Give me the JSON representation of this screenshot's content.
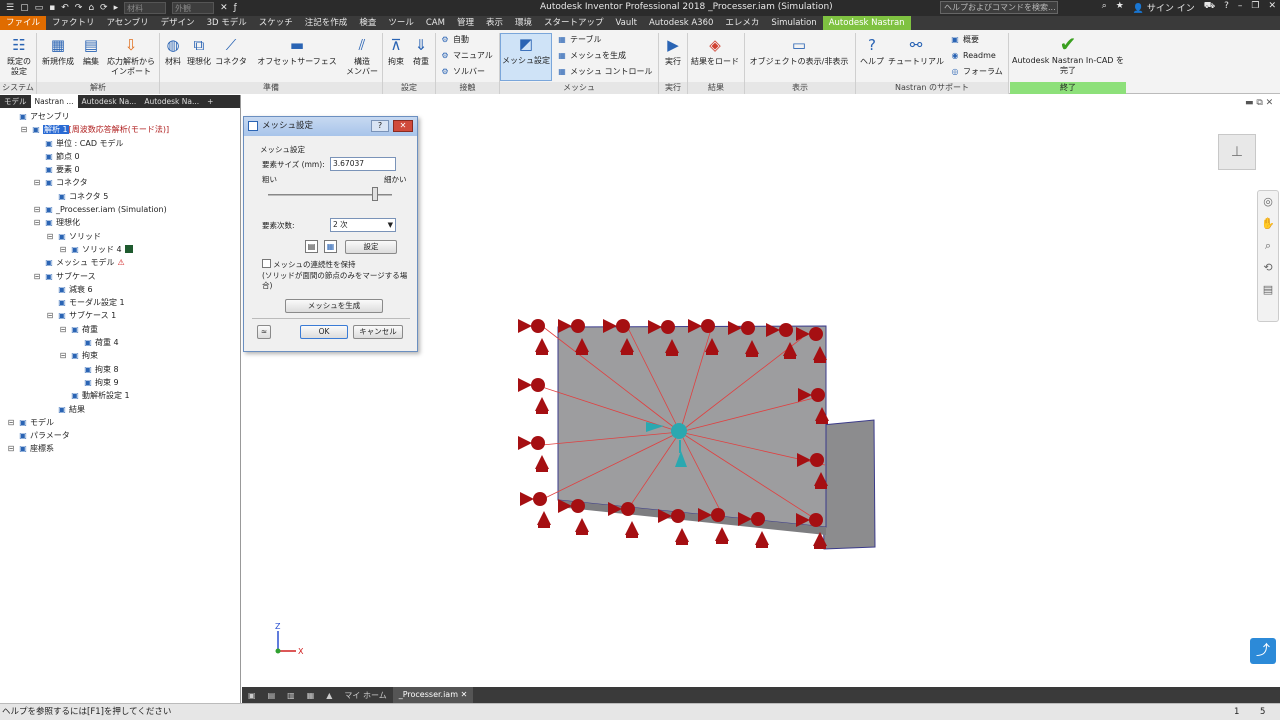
{
  "titlebar": {
    "title": "Autodesk Inventor Professional 2018   _Processer.iam (Simulation)",
    "material_placeholder": "材料",
    "appearance_placeholder": "外観",
    "search_placeholder": "ヘルプおよびコマンドを検索...",
    "signin": "サイン イン"
  },
  "menu": [
    "ファイル",
    "ファクトリ",
    "アセンブリ",
    "デザイン",
    "3D モデル",
    "スケッチ",
    "注記を作成",
    "検査",
    "ツール",
    "CAM",
    "管理",
    "表示",
    "環境",
    "スタートアップ",
    "Vault",
    "Autodesk A360",
    "エレメカ",
    "Simulation",
    "Autodesk Nastran"
  ],
  "ribbon": {
    "buttons": {
      "default_settings": "既定の\n設定",
      "new": "新規作成",
      "edit": "編集",
      "stress_import": "応力解析から\nインポート",
      "material": "材料",
      "idealize": "理想化",
      "connector": "コネクタ",
      "offset_surface": "オフセットサーフェス",
      "structural_member": "構造\nメンバー",
      "constraint": "拘束",
      "load": "荷重",
      "mesh_settings": "メッシュ設定",
      "run": "実行",
      "load_results": "結果をロード",
      "show_hide": "オブジェクトの表示/非表示",
      "help": "ヘルプ",
      "tutorial": "チュートリアル",
      "finish": "Autodesk Nastran In-CAD を\n完了"
    },
    "small": {
      "auto": "自動",
      "manual": "マニュアル",
      "solver": "ソルバー",
      "table": "テーブル",
      "generate_mesh": "メッシュを生成",
      "mesh_control": "メッシュ コントロール",
      "overview": "概要",
      "readme": "Readme",
      "forum": "フォーラム"
    },
    "groups": {
      "system": "システム",
      "analysis": "解析",
      "prepare": "準備",
      "setup": "設定",
      "contact": "接触",
      "mesh": "メッシュ",
      "run": "実行",
      "results": "結果",
      "display": "表示",
      "support": "Nastran のサポート",
      "finish": "終了"
    }
  },
  "browser": {
    "tabs": [
      "モデル",
      "Nastran ...",
      "Autodesk  Na...",
      "Autodesk  Na...",
      "+"
    ],
    "tree": [
      {
        "label": "アセンブリ",
        "icon": "assembly-icon",
        "d": 0
      },
      {
        "label": "解析 1",
        "extra": "[周波数応答解析(モード法)]",
        "icon": "analysis-icon",
        "d": 1,
        "hl": true
      },
      {
        "label": "単位 : CAD モデル",
        "icon": "units-icon",
        "d": 2
      },
      {
        "label": "節点 0",
        "icon": "node-icon",
        "d": 2
      },
      {
        "label": "要素 0",
        "icon": "element-icon",
        "d": 2
      },
      {
        "label": "コネクタ",
        "icon": "connector-icon",
        "d": 2
      },
      {
        "label": "コネクタ 5",
        "icon": "connector-item-icon",
        "d": 3
      },
      {
        "label": "_Processer.iam (Simulation)",
        "icon": "model-icon",
        "d": 2
      },
      {
        "label": "理想化",
        "icon": "idealize-icon",
        "d": 2
      },
      {
        "label": "ソリッド",
        "icon": "solid-icon",
        "d": 3
      },
      {
        "label": "ソリッド 4",
        "icon": "solid-item-icon",
        "d": 4
      },
      {
        "label": "メッシュ モデル",
        "icon": "mesh-icon",
        "d": 2,
        "warn": true
      },
      {
        "label": "サブケース",
        "icon": "subcase-icon",
        "d": 2
      },
      {
        "label": "減衰 6",
        "icon": "damping-icon",
        "d": 3
      },
      {
        "label": "モーダル設定 1",
        "icon": "modal-icon",
        "d": 3
      },
      {
        "label": "サブケース 1",
        "icon": "subcase-item-icon",
        "d": 3
      },
      {
        "label": "荷重",
        "icon": "load-icon",
        "d": 4
      },
      {
        "label": "荷重 4",
        "icon": "load-item-icon",
        "d": 5
      },
      {
        "label": "拘束",
        "icon": "constraint-icon",
        "d": 4
      },
      {
        "label": "拘束 8",
        "icon": "constraint-item-icon",
        "d": 5
      },
      {
        "label": "拘束 9",
        "icon": "constraint-item-icon",
        "d": 5
      },
      {
        "label": "動解析設定 1",
        "icon": "dynamic-icon",
        "d": 4
      },
      {
        "label": "結果",
        "icon": "results-icon",
        "d": 3
      },
      {
        "label": "モデル",
        "icon": "model-folder-icon",
        "d": 0
      },
      {
        "label": "パラメータ",
        "icon": "parameter-icon",
        "d": 0
      },
      {
        "label": "座標系",
        "icon": "coord-icon",
        "d": 0
      }
    ]
  },
  "dialog": {
    "title": "メッシュ設定",
    "help": "?",
    "close": "✕",
    "section": "メッシュ設定",
    "size_label": "要素サイズ (mm):",
    "size_value": "3.67037",
    "coarse": "粗い",
    "fine": "細かい",
    "slider": 0.86,
    "order_label": "要素次数:",
    "order_value": "2 次",
    "settings_btn": "設定",
    "continuity": "メッシュの連続性を保持",
    "note": "(ソリッドが面間の節点のみをマージする場合)",
    "generate_btn": "メッシュを生成",
    "ok": "OK",
    "cancel": "キャンセル",
    "expand": "≈"
  },
  "viewtabs": {
    "home": "マイ ホーム",
    "file": "_Processer.iam"
  },
  "status": {
    "text": "ヘルプを参照するには[F1]を押してください",
    "n1": "1",
    "n2": "5"
  },
  "axes": {
    "z": "Z",
    "x": "X"
  },
  "colors": {
    "accent": "#7fc241",
    "file": "#e06c00",
    "constraint": "#a50f12",
    "load": "#2aa8b0",
    "part": "#9d9d9f"
  }
}
